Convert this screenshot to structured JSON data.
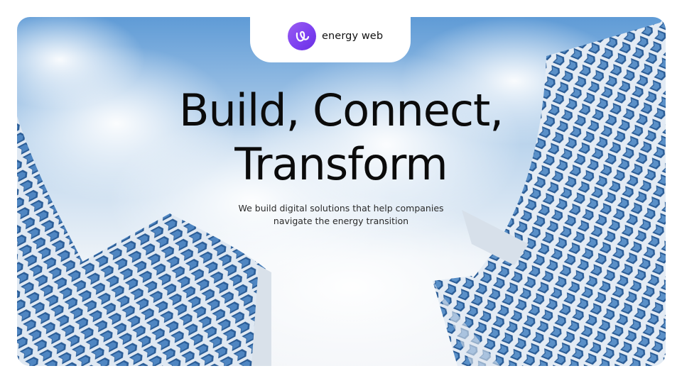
{
  "brand": {
    "name": "energy web",
    "logo_color": "#7b3ff0"
  },
  "hero": {
    "headline_line1": "Build, Connect,",
    "headline_line2": "Transform",
    "subheadline_line1": "We build digital solutions that help companies",
    "subheadline_line2": "navigate the energy transition"
  },
  "background": {
    "scene": "low-angle view of glass honeycomb-facade towers against a cloudy blue sky",
    "sky_color": "#6fa8dc",
    "facade_color": "#2f5f9e"
  }
}
